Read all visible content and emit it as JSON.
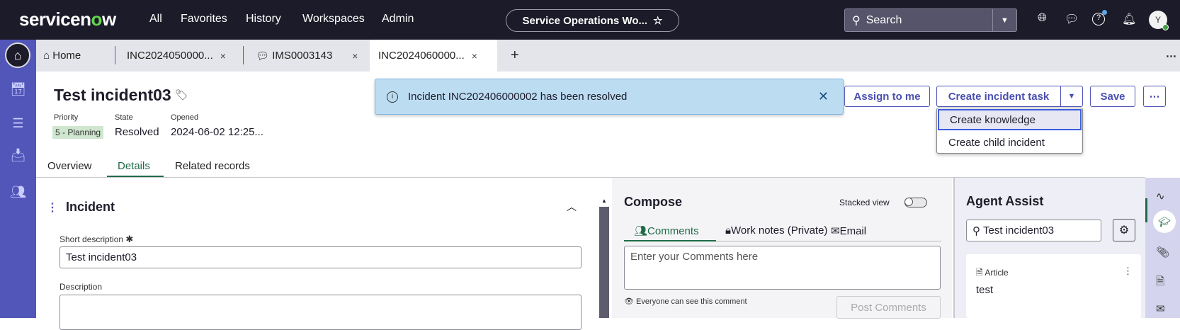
{
  "topnav": {
    "logo": "servicenow",
    "menu": [
      "All",
      "Favorites",
      "History",
      "Workspaces",
      "Admin"
    ],
    "workspace": "Service Operations Wo...",
    "search_placeholder": "Search",
    "avatar": "Y"
  },
  "tabs": [
    {
      "label": "Home"
    },
    {
      "label": "INC2024050000..."
    },
    {
      "label": "IMS0003143"
    },
    {
      "label": "INC2024060000..."
    }
  ],
  "record": {
    "title": "Test incident03",
    "priority_label": "Priority",
    "priority": "5 - Planning",
    "state_label": "State",
    "state": "Resolved",
    "opened_label": "Opened",
    "opened": "2024-06-02 12:25..."
  },
  "record_tabs": [
    "Overview",
    "Details",
    "Related records"
  ],
  "toast": "Incident INC202406000002 has been resolved",
  "actions": {
    "assign": "Assign to me",
    "create_task": "Create incident task",
    "save": "Save",
    "more": "⋯",
    "menu": [
      "Create knowledge",
      "Create child incident"
    ]
  },
  "form": {
    "section": "Incident",
    "short_desc_label": "Short description",
    "required": "✱",
    "short_desc": "Test incident03",
    "desc_label": "Description"
  },
  "compose": {
    "title": "Compose",
    "stacked": "Stacked view",
    "tabs": [
      "Comments",
      "Work notes (Private)",
      "Email"
    ],
    "placeholder": "Enter your Comments here",
    "visibility": "Everyone can see this comment",
    "post": "Post Comments"
  },
  "assist": {
    "title": "Agent Assist",
    "search": "Test incident03",
    "card_type": "Article",
    "card_title": "test"
  }
}
